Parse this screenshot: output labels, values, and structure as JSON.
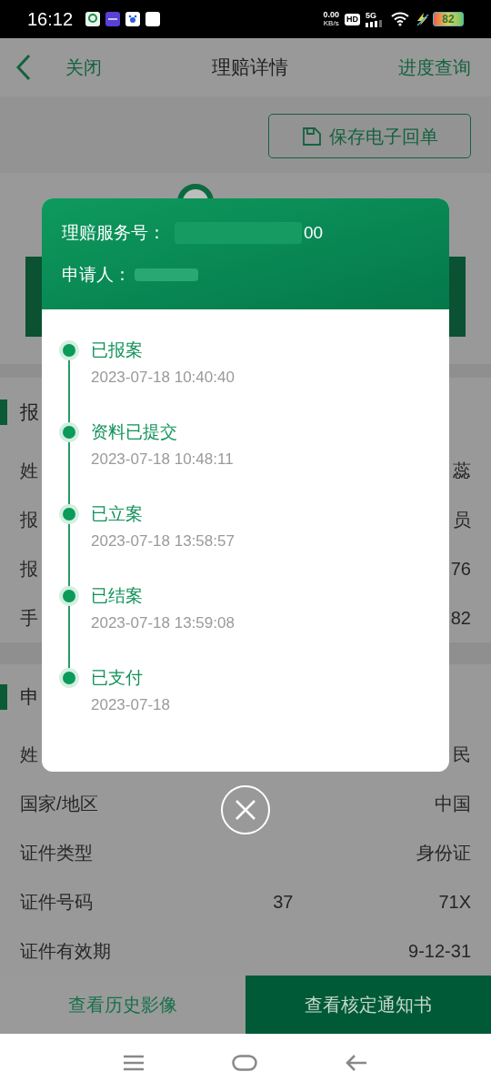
{
  "status_bar": {
    "time": "16:12",
    "net_speed": "0.00",
    "net_unit": "KB/s",
    "hd": "HD",
    "network": "5G",
    "battery": "82"
  },
  "header": {
    "close": "关闭",
    "title": "理赔详情",
    "action": "进度查询"
  },
  "save_button": "保存电子回单",
  "sections": [
    {
      "heading": "报",
      "rows": [
        {
          "label": "姓",
          "values": [
            "蕊"
          ]
        },
        {
          "label": "报",
          "values": [
            "员"
          ]
        },
        {
          "label": "报",
          "values": [
            "76"
          ]
        },
        {
          "label": "手",
          "values": [
            "82"
          ]
        }
      ]
    },
    {
      "heading": "申",
      "rows": [
        {
          "label": "姓",
          "values": [
            "民"
          ]
        },
        {
          "label": "国家/地区",
          "values": [
            "中国"
          ]
        },
        {
          "label": "证件类型",
          "values": [
            "身份证"
          ]
        },
        {
          "label": "证件号码",
          "values": [
            "37",
            "71X"
          ]
        },
        {
          "label": "证件有效期",
          "values": [
            "9-12-31"
          ]
        }
      ]
    }
  ],
  "footer_buttons": [
    {
      "label": "查看历史影像",
      "primary": false
    },
    {
      "label": "查看核定通知书",
      "primary": true
    }
  ],
  "modal": {
    "service_no_label": "理赔服务号：",
    "service_no": "00",
    "applicant_label": "申请人：",
    "timeline": [
      {
        "status": "已报案",
        "time": "2023-07-18 10:40:40"
      },
      {
        "status": "资料已提交",
        "time": "2023-07-18 10:48:11"
      },
      {
        "status": "已立案",
        "time": "2023-07-18 13:58:57"
      },
      {
        "status": "已结案",
        "time": "2023-07-18 13:59:08"
      },
      {
        "status": "已支付",
        "time": "2023-07-18"
      }
    ]
  }
}
